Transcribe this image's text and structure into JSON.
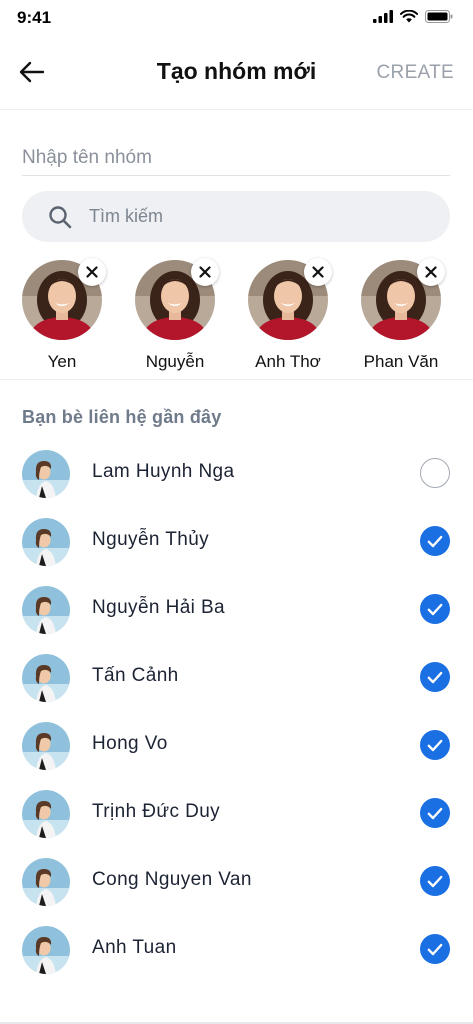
{
  "status_bar": {
    "time": "9:41"
  },
  "header": {
    "title": "Tạo nhóm mới",
    "create_label": "CREATE"
  },
  "group_name": {
    "placeholder": "Nhập tên nhóm",
    "value": ""
  },
  "search": {
    "placeholder": "Tìm kiếm",
    "value": ""
  },
  "selected": [
    {
      "name": "Yen"
    },
    {
      "name": "Nguyễn"
    },
    {
      "name": "Anh Thơ"
    },
    {
      "name": "Phan Văn"
    }
  ],
  "section_title": "Bạn bè liên hệ gần đây",
  "contacts": [
    {
      "name": "Lam Huynh Nga",
      "checked": false
    },
    {
      "name": "Nguyễn Thủy",
      "checked": true
    },
    {
      "name": "Nguyễn Hải Ba",
      "checked": true
    },
    {
      "name": "Tấn Cảnh",
      "checked": true
    },
    {
      "name": "Hong Vo",
      "checked": true
    },
    {
      "name": "Trịnh Đức Duy",
      "checked": true
    },
    {
      "name": "Cong Nguyen Van",
      "checked": true
    },
    {
      "name": "Anh Tuan",
      "checked": true
    }
  ],
  "colors": {
    "accent": "#1a6fe3",
    "create_disabled": "#9aa1ab",
    "section_title": "#6f7a8a"
  }
}
